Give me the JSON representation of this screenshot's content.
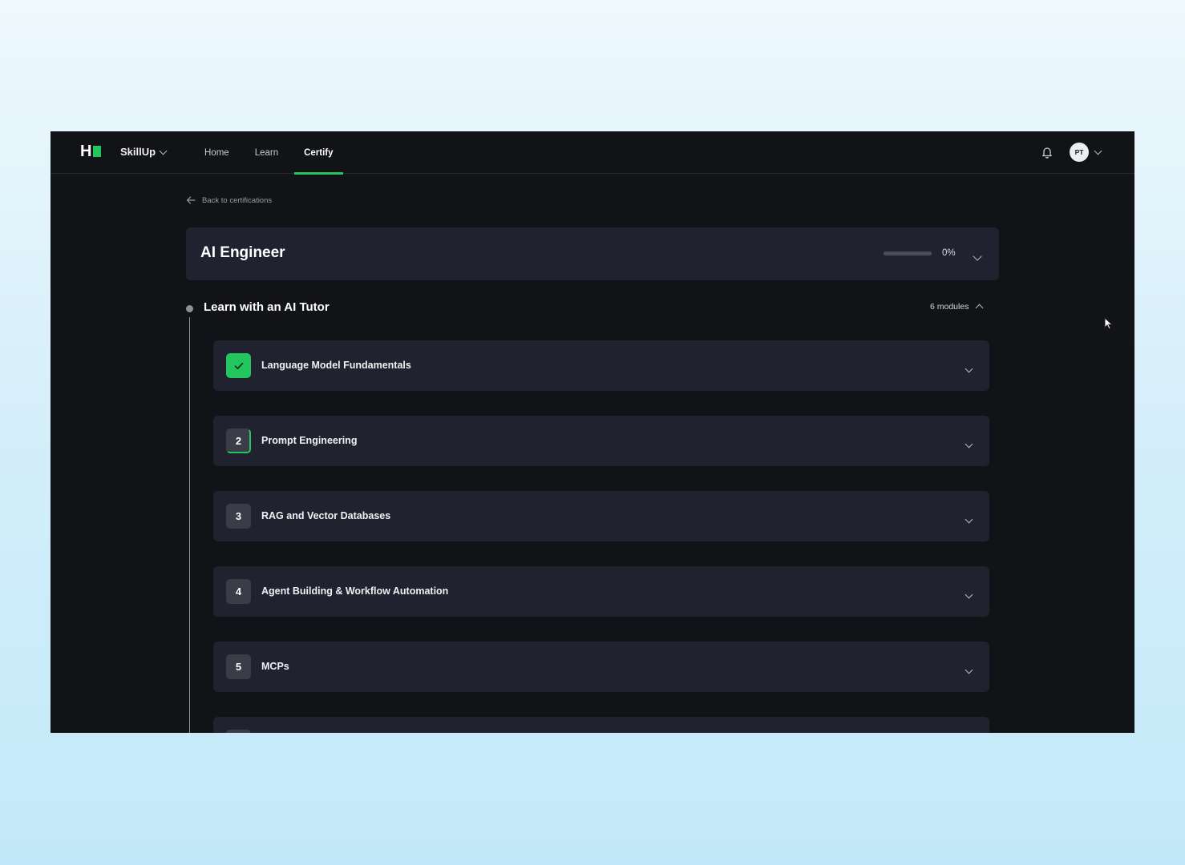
{
  "nav": {
    "brand": "SkillUp",
    "links": [
      {
        "label": "Home",
        "active": false
      },
      {
        "label": "Learn",
        "active": false
      },
      {
        "label": "Certify",
        "active": true
      }
    ],
    "avatar_initials": "PT",
    "accent_color": "#22c55e"
  },
  "back_link": "Back to certifications",
  "certification": {
    "title": "AI Engineer",
    "progress_percent": 0,
    "progress_label": "0%"
  },
  "section": {
    "title": "Learn with an AI Tutor",
    "modules_count_label": "6 modules"
  },
  "modules": [
    {
      "badge": "",
      "status": "completed",
      "title": "Language Model Fundamentals"
    },
    {
      "badge": "2",
      "status": "in-progress",
      "title": "Prompt Engineering"
    },
    {
      "badge": "3",
      "status": "not-started",
      "title": "RAG and Vector Databases"
    },
    {
      "badge": "4",
      "status": "not-started",
      "title": "Agent Building & Workflow Automation"
    },
    {
      "badge": "5",
      "status": "not-started",
      "title": "MCPs"
    }
  ],
  "icons": {
    "bell": "bell-icon",
    "back": "arrow-left-icon",
    "check": "check-icon",
    "chevron": "chevron-down-icon"
  }
}
